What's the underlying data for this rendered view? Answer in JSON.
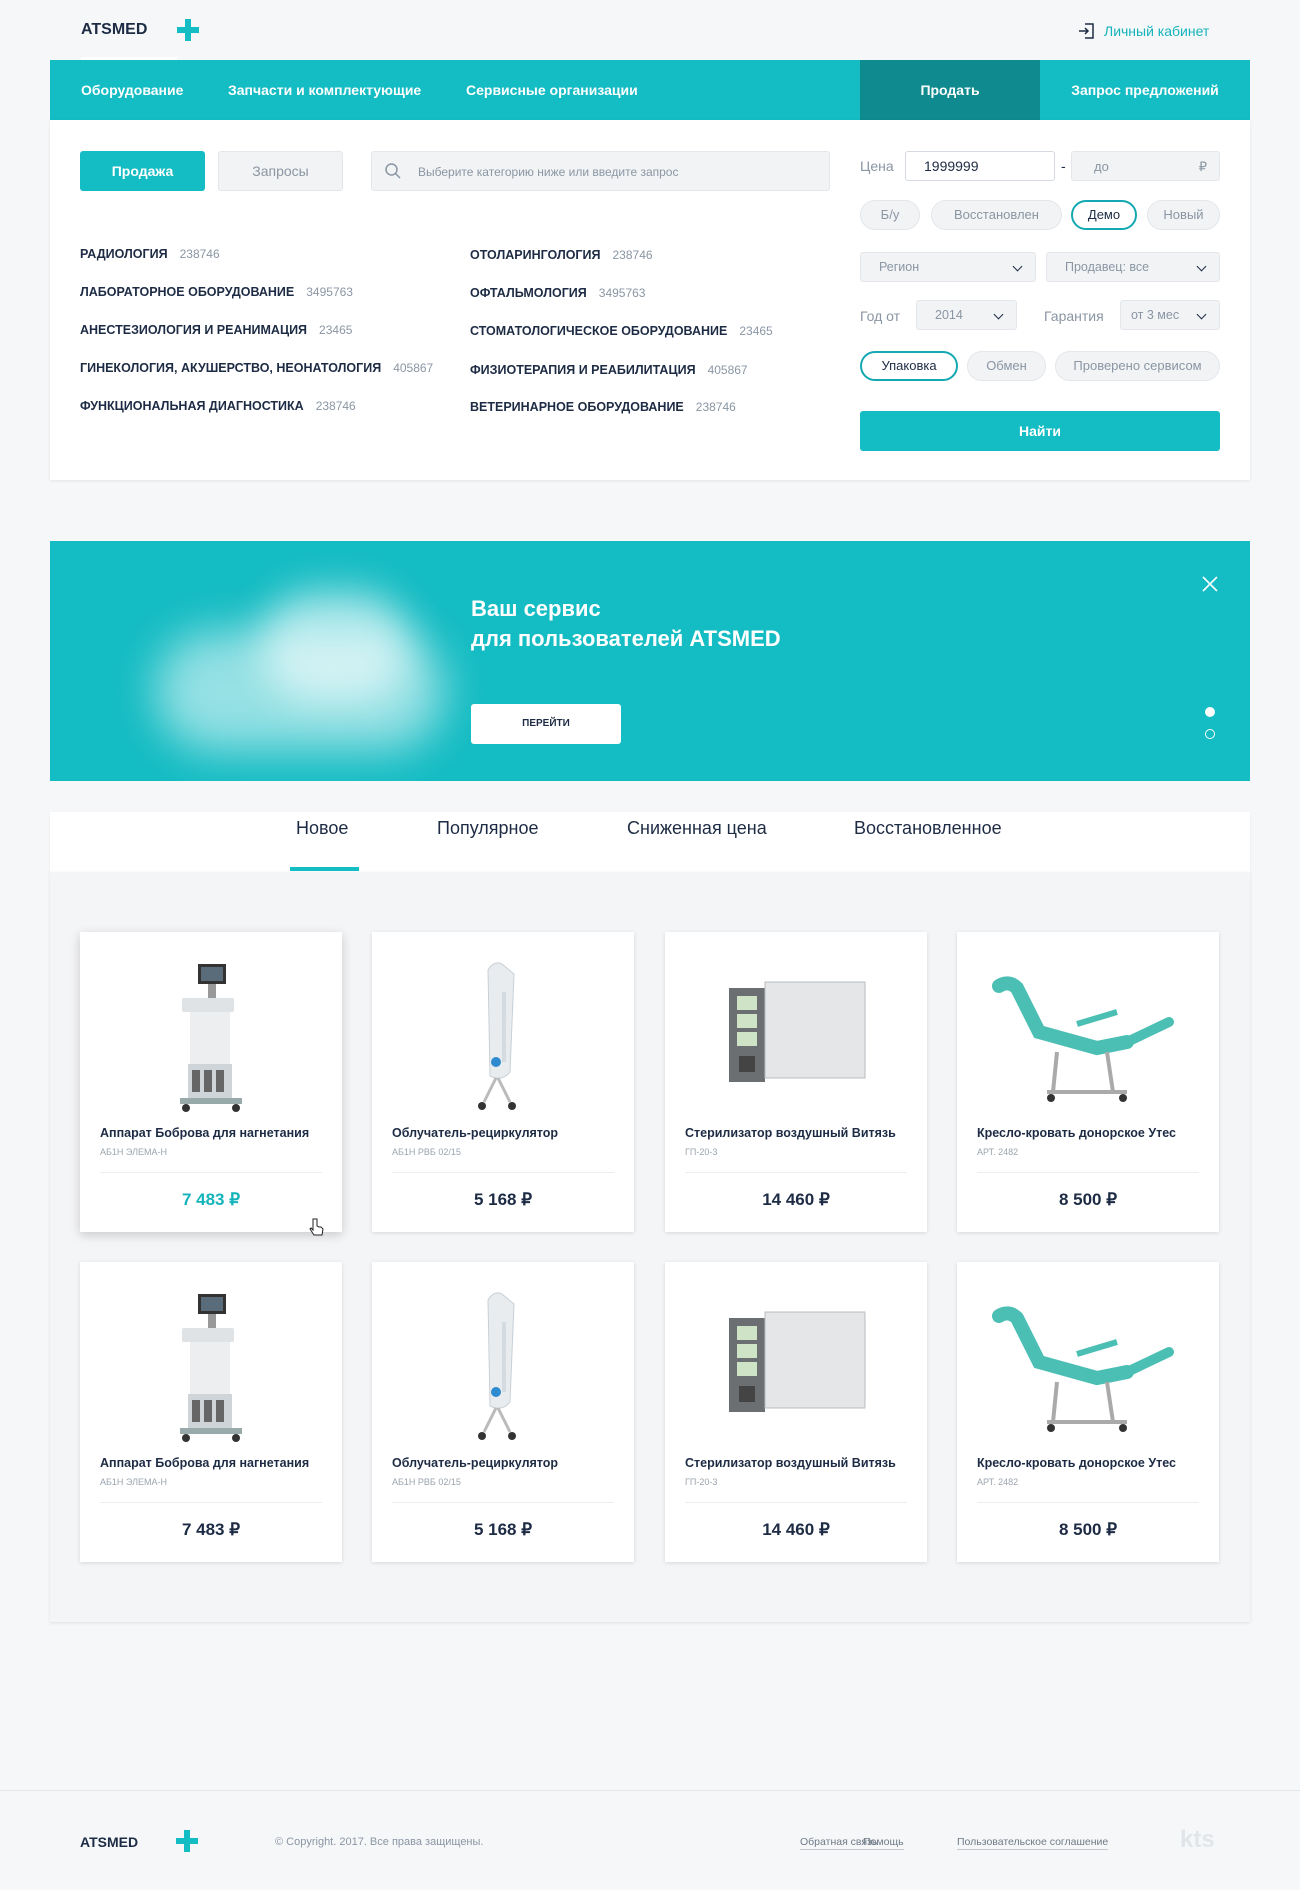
{
  "header": {
    "logo": "ATSMED",
    "account": "Личный кабинет"
  },
  "nav": {
    "items": [
      "Оборудование",
      "Запчасти и комплектующие",
      "Сервисные организации"
    ],
    "sell": "Продать",
    "request": "Запрос предложений"
  },
  "search": {
    "tab_sale": "Продажа",
    "tab_requests": "Запросы",
    "placeholder": "Выберите категорию ниже или введите запрос"
  },
  "categories": [
    {
      "name": "РАДИОЛОГИЯ",
      "count": "238746"
    },
    {
      "name": "ЛАБОРАТОРНОЕ ОБОРУДОВАНИЕ",
      "count": "3495763"
    },
    {
      "name": "АНЕСТЕЗИОЛОГИЯ И РЕАНИМАЦИЯ",
      "count": "23465"
    },
    {
      "name": "ГИНЕКОЛОГИЯ, АКУШЕРСТВО, НЕОНАТОЛОГИЯ",
      "count": "405867"
    },
    {
      "name": "ФУНКЦИОНАЛЬНАЯ ДИАГНОСТИКА",
      "count": "238746"
    },
    {
      "name": "ОТОЛАРИНГОЛОГИЯ",
      "count": "238746"
    },
    {
      "name": "ОФТАЛЬМОЛОГИЯ",
      "count": "3495763"
    },
    {
      "name": "СТОМАТОЛОГИЧЕСКОЕ ОБОРУДОВАНИЕ",
      "count": "23465"
    },
    {
      "name": "ФИЗИОТЕРАПИЯ И РЕАБИЛИТАЦИЯ",
      "count": "405867"
    },
    {
      "name": "ВЕТЕРИНАРНОЕ ОБОРУДОВАНИЕ",
      "count": "238746"
    }
  ],
  "filters": {
    "price_label": "Цена",
    "price_from": "1999999",
    "price_sep": "-",
    "price_to_placeholder": "до",
    "currency": "₽",
    "conditions": [
      "Б/у",
      "Восстановлен",
      "Демо",
      "Новый"
    ],
    "region": "Регион",
    "seller": "Продавец: все",
    "year_label": "Год от",
    "year_value": "2014",
    "warranty_label": "Гарантия",
    "warranty_value": "от 3 мес",
    "extras": [
      "Упаковка",
      "Обмен",
      "Проверено сервисом"
    ],
    "find": "Найти"
  },
  "banner": {
    "line1": "Ваш сервис",
    "line2": "для пользователей ATSMED",
    "button": "ПЕРЕЙТИ"
  },
  "tabs": [
    "Новое",
    "Популярное",
    "Сниженная цена",
    "Восстановленное"
  ],
  "products": [
    {
      "title": "Аппарат Боброва для нагнетания",
      "code": "АБ1Н ЭЛЕМА-Н",
      "price": "7 483 ₽"
    },
    {
      "title": "Облучатель-рециркулятор",
      "code": "АБ1Н РВБ 02/15",
      "price": "5 168 ₽"
    },
    {
      "title": "Стерилизатор воздушный Витязь",
      "code": "ГП-20-3",
      "price": "14 460 ₽"
    },
    {
      "title": "Кресло-кровать донорское Утес",
      "code": "АРТ. 2482",
      "price": "8 500 ₽"
    },
    {
      "title": "Аппарат Боброва для нагнетания",
      "code": "АБ1Н ЭЛЕМА-Н",
      "price": "7 483 ₽"
    },
    {
      "title": "Облучатель-рециркулятор",
      "code": "АБ1Н РВБ 02/15",
      "price": "5 168 ₽"
    },
    {
      "title": "Стерилизатор воздушный Витязь",
      "code": "ГП-20-3",
      "price": "14 460 ₽"
    },
    {
      "title": "Кресло-кровать донорское Утес",
      "code": "АРТ. 2482",
      "price": "8 500 ₽"
    }
  ],
  "footer": {
    "logo": "ATSMED",
    "copyright": "© Copyright. 2017. Все права защищены.",
    "links": [
      "Обратная связь",
      "Помощь",
      "Пользовательское соглашение"
    ],
    "brand": "kts"
  },
  "colors": {
    "accent": "#14bcc3",
    "accent_dark": "#0f8a8e",
    "text": "#1d2b44"
  }
}
